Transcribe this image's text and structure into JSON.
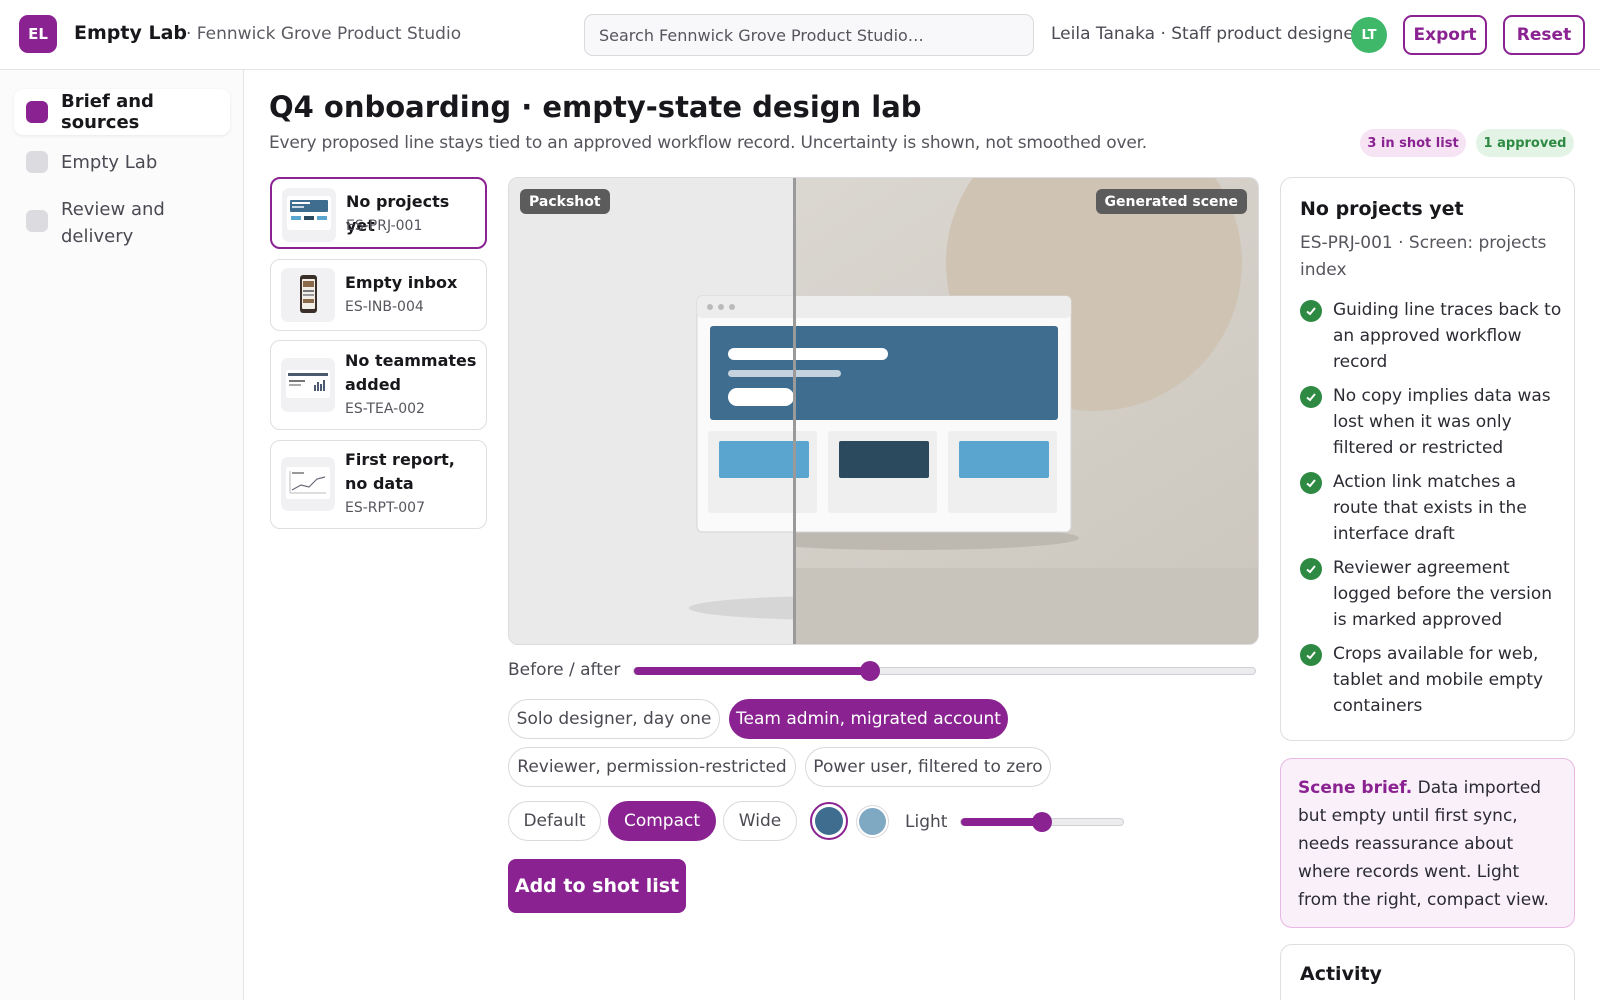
{
  "app": {
    "logo_initials": "EL",
    "name": "Empty Lab",
    "workspace": "· Fennwick Grove Product Studio"
  },
  "search": {
    "placeholder": "Search Fennwick Grove Product Studio…"
  },
  "user": {
    "name": "Leila Tanaka · Staff product designer",
    "initials": "LT"
  },
  "toolbar": {
    "export_label": "Export",
    "reset_label": "Reset"
  },
  "sidebar": {
    "items": [
      {
        "label": "Brief and sources",
        "active": true
      },
      {
        "label": "Empty Lab",
        "active": false
      },
      {
        "label": "Review and delivery",
        "active": false
      }
    ]
  },
  "header": {
    "title": "Q4 onboarding · empty-state design lab",
    "subtitle": "Every proposed line stays tied to an approved workflow record. Uncertainty is shown, not smoothed over.",
    "badges": {
      "shot_list": "3 in shot list",
      "approved": "1 approved"
    }
  },
  "screens": [
    {
      "title": "No projects yet",
      "code": "ES-PRJ-001",
      "selected": true
    },
    {
      "title": "Empty inbox",
      "code": "ES-INB-004",
      "selected": false
    },
    {
      "title": "No teammates added",
      "code": "ES-TEA-002",
      "selected": false
    },
    {
      "title": "First report, no data",
      "code": "ES-RPT-007",
      "selected": false
    }
  ],
  "stage": {
    "left_label": "Packshot",
    "right_label": "Generated scene",
    "split_fraction": 0.38
  },
  "before_after": {
    "label": "Before / after",
    "value": 0.38
  },
  "personas": {
    "options": [
      "Solo designer, day one",
      "Team admin, migrated account",
      "Reviewer, permission-restricted",
      "Power user, filtered to zero"
    ],
    "selected": "Team admin, migrated account"
  },
  "density": {
    "options": [
      "Default",
      "Compact",
      "Wide"
    ],
    "selected": "Compact"
  },
  "swatches": {
    "colors": [
      "#3e6d8f",
      "#7fa8c2"
    ],
    "selected_index": 0
  },
  "light": {
    "label": "Light",
    "value": 0.5
  },
  "primary_action": {
    "label": "Add to shot list"
  },
  "detail": {
    "title": "No projects yet",
    "meta": "ES-PRJ-001 · Screen: projects index",
    "checks": [
      "Guiding line traces back to an approved workflow record",
      "No copy implies data was lost when it was only filtered or restricted",
      "Action link matches a route that exists in the interface draft",
      "Reviewer agreement logged before the version is marked approved",
      "Crops available for web, tablet and mobile empty containers"
    ]
  },
  "brief": {
    "lead": "Scene brief.",
    "text": "Data imported but empty until first sync, needs reassurance about where records went. Light from the right, compact view."
  },
  "activity": {
    "title": "Activity"
  },
  "colors": {
    "accent": "#8a2391",
    "success": "#2e8a43",
    "avatar": "#3fb86a"
  }
}
